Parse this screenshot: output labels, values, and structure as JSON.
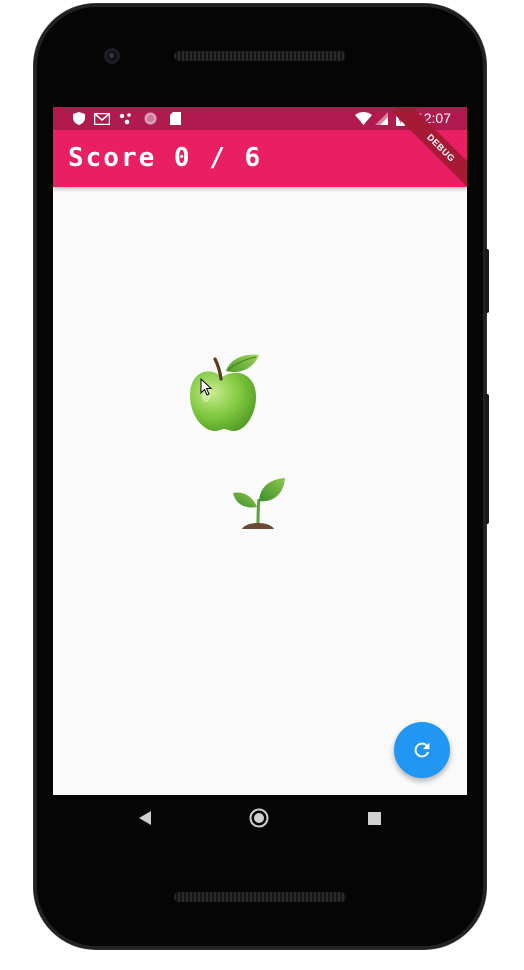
{
  "status_bar": {
    "time": "12:07",
    "left_icons": [
      "shield-icon",
      "gmail-icon",
      "nodes-icon",
      "circle-icon",
      "sd-card-icon"
    ],
    "right_icons": [
      "wifi-icon",
      "signal-icon",
      "battery-icon"
    ]
  },
  "app_bar": {
    "title": "Score 0 / 6",
    "debug_label": "DEBUG",
    "color": "#e91e63"
  },
  "content": {
    "items": [
      {
        "name": "apple",
        "icon": "green-apple-icon"
      },
      {
        "name": "seedling",
        "icon": "seedling-icon"
      }
    ]
  },
  "fab": {
    "icon": "refresh-icon",
    "color": "#2196f3"
  },
  "nav_bar": {
    "buttons": [
      "back-icon",
      "home-icon",
      "recents-icon"
    ]
  }
}
